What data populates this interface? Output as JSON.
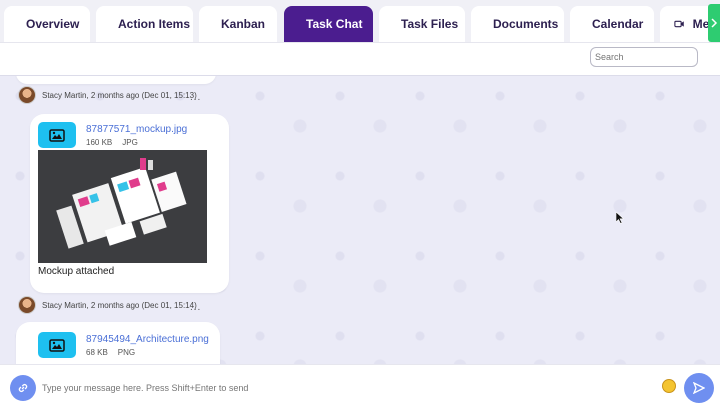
{
  "tabs": [
    {
      "label": "Overview",
      "icon": "clipboard-icon",
      "active": false
    },
    {
      "label": "Action Items",
      "icon": "list-icon",
      "active": false
    },
    {
      "label": "Kanban",
      "icon": "checklist-icon",
      "active": false
    },
    {
      "label": "Task Chat",
      "icon": "chat-icon",
      "active": true
    },
    {
      "label": "Task Files",
      "icon": "grid-icon",
      "active": false
    },
    {
      "label": "Documents",
      "icon": "folder-icon",
      "active": false
    },
    {
      "label": "Calendar",
      "icon": "calendar-icon",
      "active": false
    },
    {
      "label": "Mee",
      "icon": "video-icon",
      "active": false
    }
  ],
  "toolbar": {
    "search_placeholder": "Search"
  },
  "messages": [
    {
      "author_meta": "Stacy Martin, 2 months ago (Dec 01, 15:13)",
      "more": "..."
    },
    {
      "file_name": "87877571_mockup.jpg",
      "size": "160 KB",
      "ext": "JPG",
      "caption": "Mockup attached",
      "author_meta": "Stacy Martin, 2 months ago (Dec 01, 15:14)",
      "more": "..."
    },
    {
      "file_name": "87945494_Architecture.png",
      "size": "68 KB",
      "ext": "PNG"
    }
  ],
  "composer": {
    "placeholder": "Type your message here. Press Shift+Enter to send"
  },
  "colors": {
    "accent": "#4b1d8f",
    "primary_button": "#6f8ff0",
    "file_icon": "#1ec0f0",
    "scroll_tab": "#2ecc71"
  }
}
